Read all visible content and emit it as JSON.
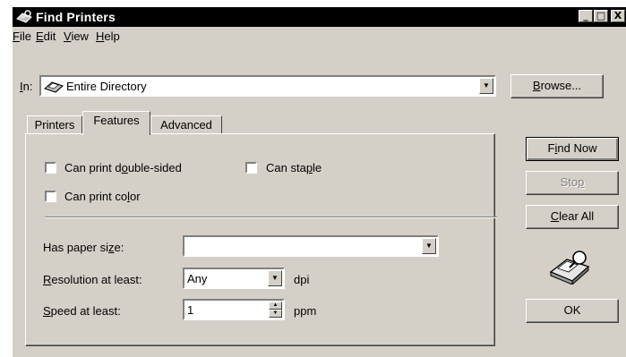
{
  "window": {
    "title": "Find Printers",
    "controls": [
      "_",
      "□",
      "X"
    ]
  },
  "menu": [
    {
      "pre": "",
      "key": "F",
      "post": "ile"
    },
    {
      "pre": "",
      "key": "E",
      "post": "dit"
    },
    {
      "pre": "",
      "key": "V",
      "post": "iew"
    },
    {
      "pre": "",
      "key": "H",
      "post": "elp"
    }
  ],
  "scope": {
    "label_key": "I",
    "label_post": "n:",
    "value": "Entire Directory",
    "browse_key": "B",
    "browse_post": "rowse..."
  },
  "tabs": [
    {
      "label": "Printers",
      "selected": false
    },
    {
      "label": "Features",
      "selected": true
    },
    {
      "label": "Advanced",
      "selected": false
    }
  ],
  "features": {
    "double_sided": {
      "pre": "Can print d",
      "key": "o",
      "post": "uble-sided",
      "checked": false
    },
    "staple": {
      "pre": "Can sta",
      "key": "p",
      "post": "le",
      "checked": false
    },
    "color": {
      "pre": "Can print co",
      "key": "l",
      "post": "or",
      "checked": false
    },
    "paper_size": {
      "pre": "Has paper si",
      "key": "z",
      "post": "e:",
      "value": ""
    },
    "resolution": {
      "pre": "",
      "key": "R",
      "post": "esolution at least:",
      "value": "Any",
      "unit": "dpi"
    },
    "speed": {
      "pre": "",
      "key": "S",
      "post": "peed at least:",
      "value": "1",
      "unit": "ppm"
    }
  },
  "buttons": {
    "find_now": {
      "pre": "F",
      "key": "i",
      "post": "nd Now"
    },
    "stop": {
      "pre": "Sto",
      "key": "p",
      "post": ""
    },
    "clear_all": {
      "pre": "",
      "key": "C",
      "post": "lear All"
    },
    "ok": "OK"
  }
}
